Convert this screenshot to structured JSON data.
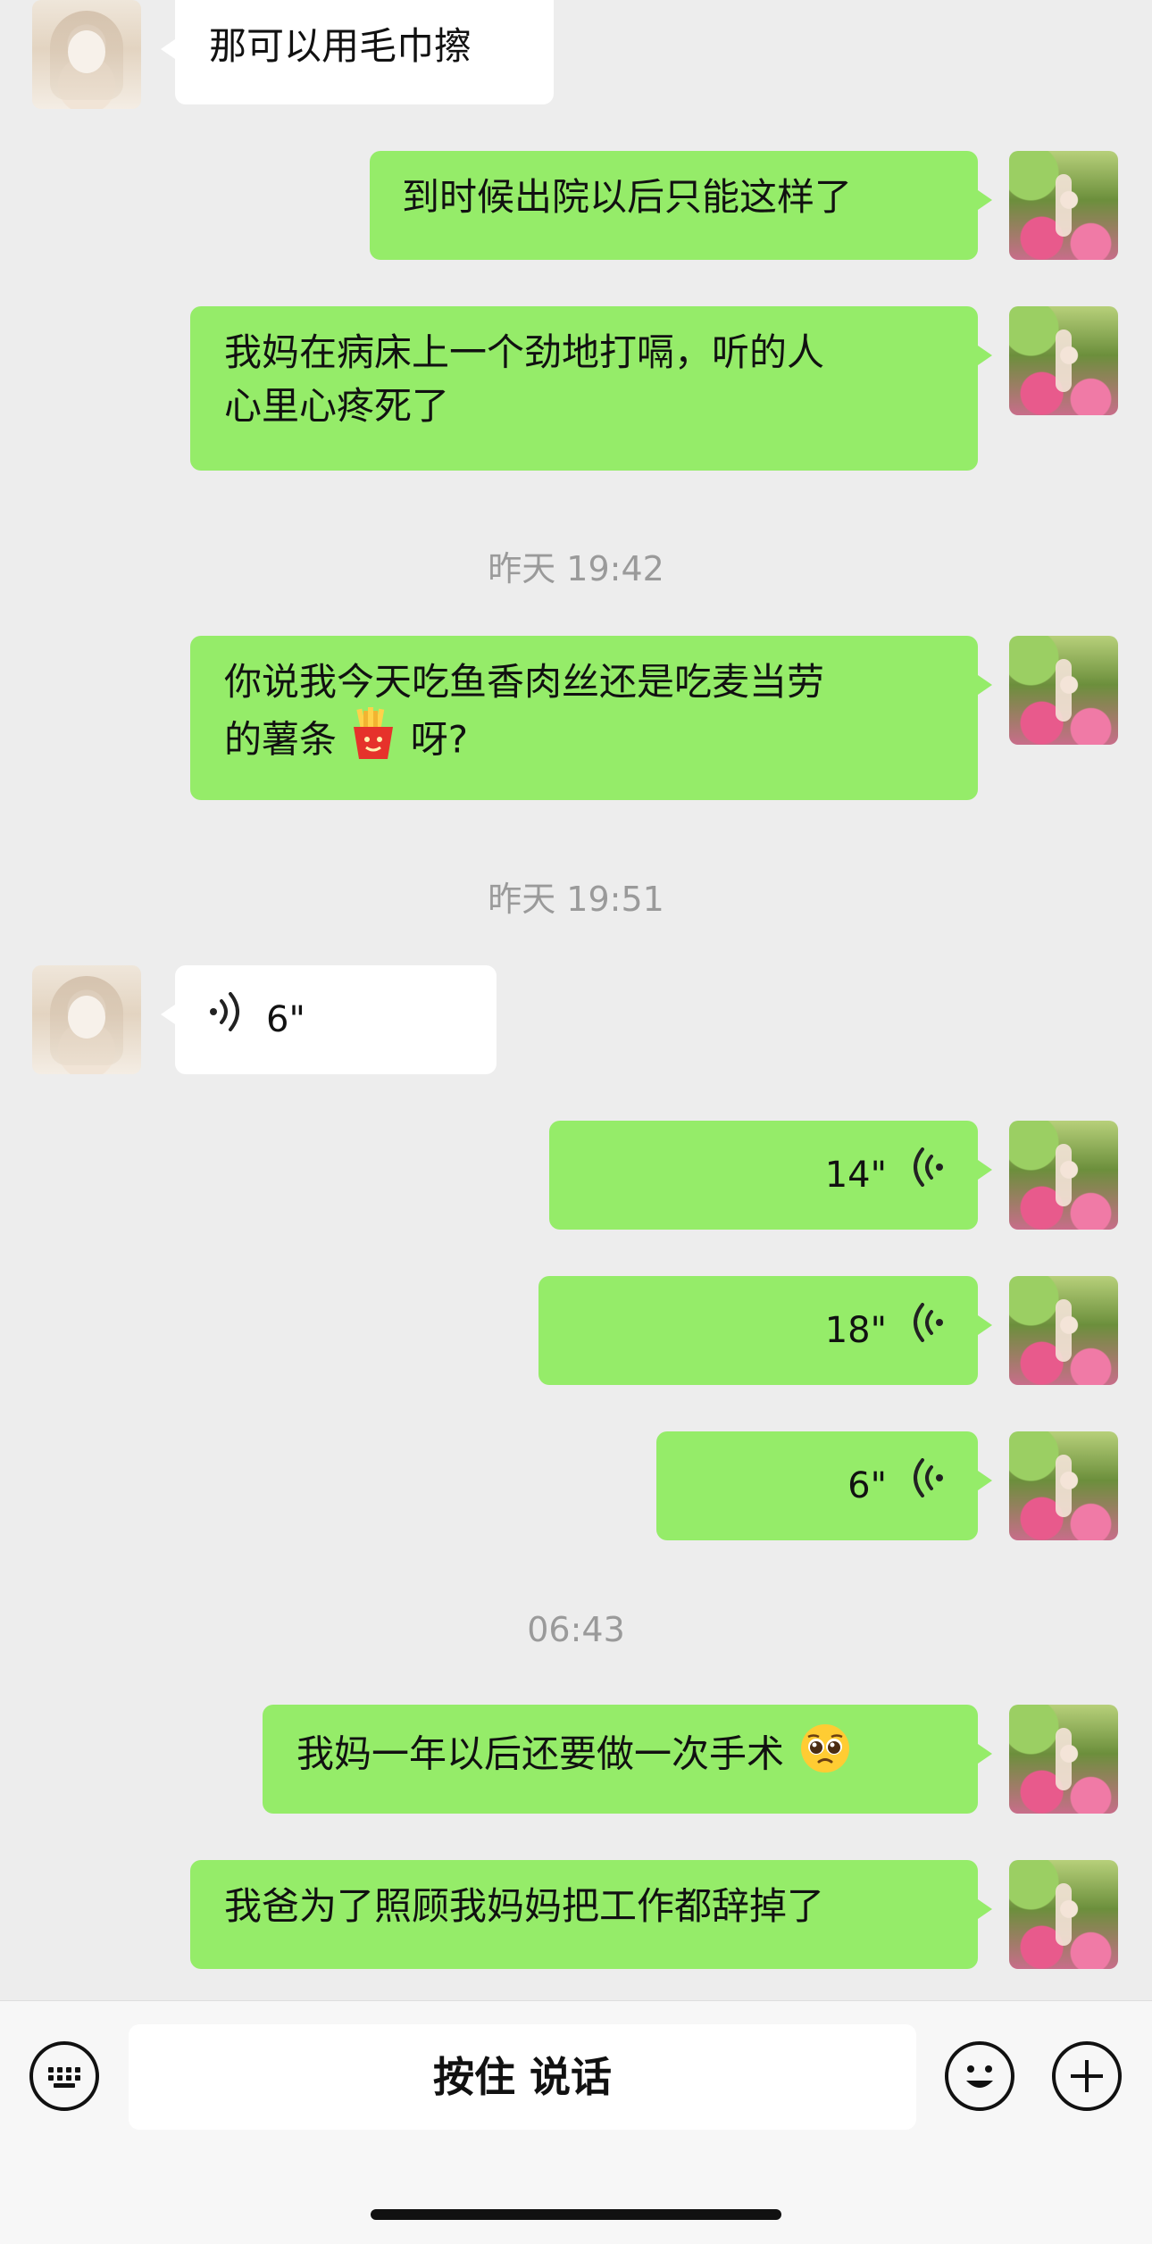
{
  "chat": {
    "messages": [
      {
        "text": "那可以用毛巾擦"
      },
      {
        "text": "到时候出院以后只能这样了"
      },
      {
        "line1": "我妈在病床上一个劲地打嗝，听的人",
        "line2": "心里心疼死了"
      },
      {
        "line1": "你说我今天吃鱼香肉丝还是吃麦当劳",
        "line2_before": "的薯条",
        "line2_after": "呀?"
      },
      {
        "duration": "6\""
      },
      {
        "duration": "14\""
      },
      {
        "duration": "18\""
      },
      {
        "duration": "6\""
      },
      {
        "text": "我妈一年以后还要做一次手术"
      },
      {
        "text": "我爸为了照顾我妈妈把工作都辞掉了"
      }
    ],
    "timestamps": [
      "昨天 19:42",
      "昨天 19:51",
      "06:43"
    ]
  },
  "input_bar": {
    "talk_label": "按住 说话",
    "icons": [
      "keyboard-icon",
      "emoji-face-icon",
      "plus-icon"
    ]
  },
  "colors": {
    "background": "#ededed",
    "my_bubble": "#95ec69",
    "other_bubble": "#ffffff"
  }
}
